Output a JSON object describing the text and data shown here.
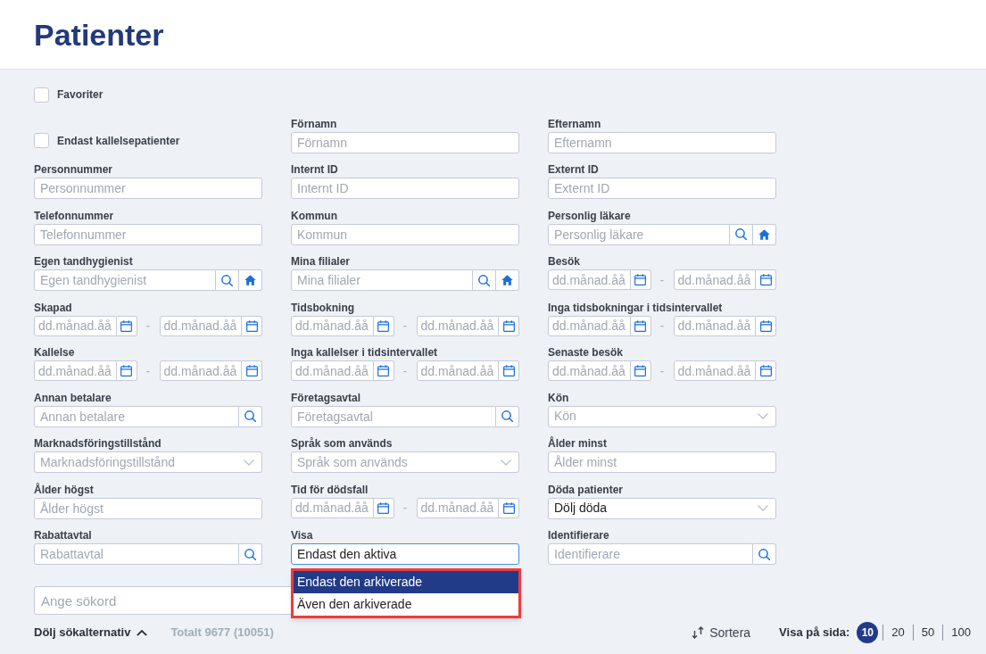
{
  "header": {
    "title": "Patienter"
  },
  "filters": {
    "rows": [
      [
        {
          "kind": "checkbox",
          "label": "Favoriter",
          "checked": false
        }
      ],
      [
        {
          "kind": "checkbox",
          "label": "Endast kallelsepatienter",
          "checked": false
        },
        {
          "kind": "text",
          "label": "Förnamn",
          "placeholder": "Förnamn"
        },
        {
          "kind": "text",
          "label": "Efternamn",
          "placeholder": "Efternamn"
        }
      ],
      [
        {
          "kind": "text",
          "label": "Personnummer",
          "placeholder": "Personnummer"
        },
        {
          "kind": "text",
          "label": "Internt ID",
          "placeholder": "Internt ID"
        },
        {
          "kind": "text",
          "label": "Externt ID",
          "placeholder": "Externt ID"
        }
      ],
      [
        {
          "kind": "text",
          "label": "Telefonnummer",
          "placeholder": "Telefonnummer"
        },
        {
          "kind": "text",
          "label": "Kommun",
          "placeholder": "Kommun"
        },
        {
          "kind": "search_home",
          "label": "Personlig läkare",
          "placeholder": "Personlig läkare"
        }
      ],
      [
        {
          "kind": "search_home",
          "label": "Egen tandhygienist",
          "placeholder": "Egen tandhygienist"
        },
        {
          "kind": "search_home",
          "label": "Mina filialer",
          "placeholder": "Mina filialer"
        },
        {
          "kind": "date_range",
          "label": "Besök",
          "from_placeholder": "dd.månad.åå",
          "separator": "-",
          "to_placeholder": "dd.månad.åå"
        }
      ],
      [
        {
          "kind": "date_range",
          "label": "Skapad",
          "from_placeholder": "dd.månad.åå",
          "separator": "-",
          "to_placeholder": "dd.månad.åå"
        },
        {
          "kind": "date_range",
          "label": "Tidsbokning",
          "from_placeholder": "dd.månad.åå",
          "separator": "-",
          "to_placeholder": "dd.månad.åå"
        },
        {
          "kind": "date_range",
          "label": "Inga tidsbokningar i tidsintervallet",
          "from_placeholder": "dd.månad.åå",
          "separator": "-",
          "to_placeholder": "dd.månad.åå"
        }
      ],
      [
        {
          "kind": "date_range",
          "label": "Kallelse",
          "from_placeholder": "dd.månad.åå",
          "separator": "-",
          "to_placeholder": "dd.månad.åå"
        },
        {
          "kind": "date_range",
          "label": "Inga kallelser i tidsintervallet",
          "from_placeholder": "dd.månad.åå",
          "separator": "-",
          "to_placeholder": "dd.månad.åå"
        },
        {
          "kind": "date_range",
          "label": "Senaste besök",
          "from_placeholder": "dd.månad.åå",
          "separator": "-",
          "to_placeholder": "dd.månad.åå"
        }
      ],
      [
        {
          "kind": "search",
          "label": "Annan betalare",
          "placeholder": "Annan betalare"
        },
        {
          "kind": "search",
          "label": "Företagsavtal",
          "placeholder": "Företagsavtal"
        },
        {
          "kind": "select",
          "label": "Kön",
          "placeholder": "Kön",
          "open": false
        }
      ],
      [
        {
          "kind": "select",
          "label": "Marknadsföringstillstånd",
          "placeholder": "Marknadsföringstillstånd",
          "open": false
        },
        {
          "kind": "select",
          "label": "Språk som används",
          "placeholder": "Språk som används",
          "open": false
        },
        {
          "kind": "text",
          "label": "Ålder minst",
          "placeholder": "Ålder minst"
        }
      ],
      [
        {
          "kind": "text",
          "label": "Ålder högst",
          "placeholder": "Ålder högst"
        },
        {
          "kind": "date_range",
          "label": "Tid för dödsfall",
          "from_placeholder": "dd.månad.åå",
          "separator": "-",
          "to_placeholder": "dd.månad.åå"
        },
        {
          "kind": "select",
          "label": "Döda patienter",
          "value": "Dölj döda",
          "open": false
        }
      ],
      [
        {
          "kind": "search",
          "label": "Rabattavtal",
          "placeholder": "Rabattavtal"
        },
        {
          "kind": "select",
          "label": "Visa",
          "value": "Endast den aktiva",
          "open": true,
          "options": [
            {
              "label": "Endast den arkiverade",
              "highlighted": true
            },
            {
              "label": "Även den arkiverade",
              "highlighted": false
            }
          ]
        },
        {
          "kind": "search",
          "label": "Identifierare",
          "placeholder": "Identifierare"
        }
      ]
    ],
    "keyword_search": {
      "placeholder": "Ange sökord"
    }
  },
  "toolbar": {
    "toggle_label": "Dölj sökalternativ",
    "expanded": true,
    "total": "Totalt 9677 (10051)",
    "sort_label": "Sortera",
    "page_size_label": "Visa på sida:",
    "page_sizes": [
      {
        "label": "10",
        "selected": true
      },
      {
        "label": "20",
        "selected": false
      },
      {
        "label": "50",
        "selected": false
      },
      {
        "label": "100",
        "selected": false
      }
    ]
  }
}
